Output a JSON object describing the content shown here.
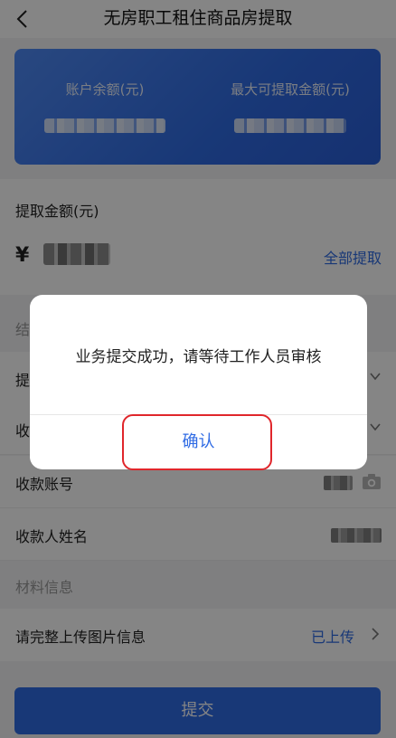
{
  "header": {
    "title": "无房职工租住商品房提取",
    "back_icon": "chevron-left-icon"
  },
  "card": {
    "balance_label": "账户余额(元)",
    "max_label": "最大可提取金额(元)"
  },
  "amount": {
    "label": "提取金额(元)",
    "currency": "¥",
    "withdraw_all": "全部提取"
  },
  "sections": {
    "section1_partial": "结",
    "materials": "材料信息"
  },
  "rows": {
    "row1_partial": "提",
    "row2_partial": "收",
    "account_number": "收款账号",
    "payee_name": "收款人姓名",
    "upload_prompt": "请完整上传图片信息",
    "upload_status": "已上传"
  },
  "submit_label": "提交",
  "dialog": {
    "message": "业务提交成功，请等待工作人员审核",
    "confirm_label": "确认"
  },
  "colors": {
    "accent": "#2f6be4",
    "highlight": "#e0262b"
  }
}
